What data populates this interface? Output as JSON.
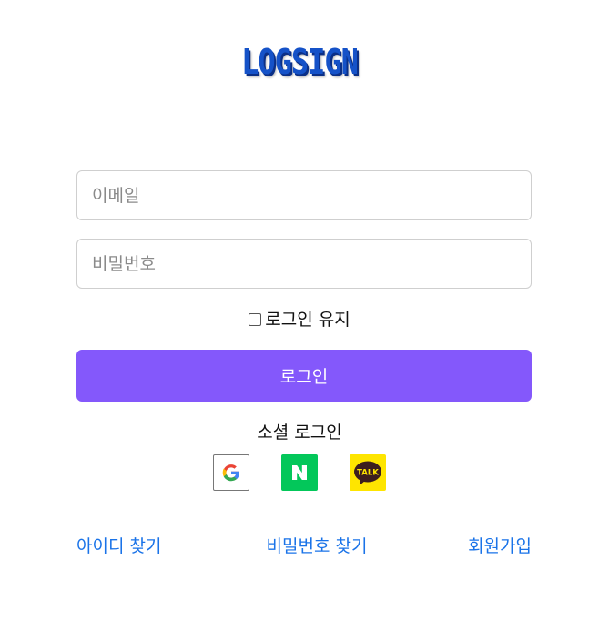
{
  "brand": {
    "logo_text": "LOGSIGN",
    "primary_color": "#8458fb",
    "logo_color": "#1552c8",
    "link_color": "#1a73e8"
  },
  "form": {
    "email_placeholder": "이메일",
    "email_value": "",
    "password_placeholder": "비밀번호",
    "password_value": "",
    "remember_label": "로그인 유지",
    "remember_checked": false,
    "login_label": "로그인"
  },
  "social": {
    "heading": "소셜 로그인",
    "providers": [
      {
        "name": "google",
        "icon": "google-icon",
        "color": "#ffffff"
      },
      {
        "name": "naver",
        "icon": "naver-icon",
        "color": "#03c75a",
        "glyph": "N"
      },
      {
        "name": "kakao",
        "icon": "kakao-icon",
        "color": "#fee500",
        "glyph": "TALK"
      }
    ]
  },
  "links": {
    "find_id": "아이디 찾기",
    "find_password": "비밀번호 찾기",
    "signup": "회원가입"
  }
}
